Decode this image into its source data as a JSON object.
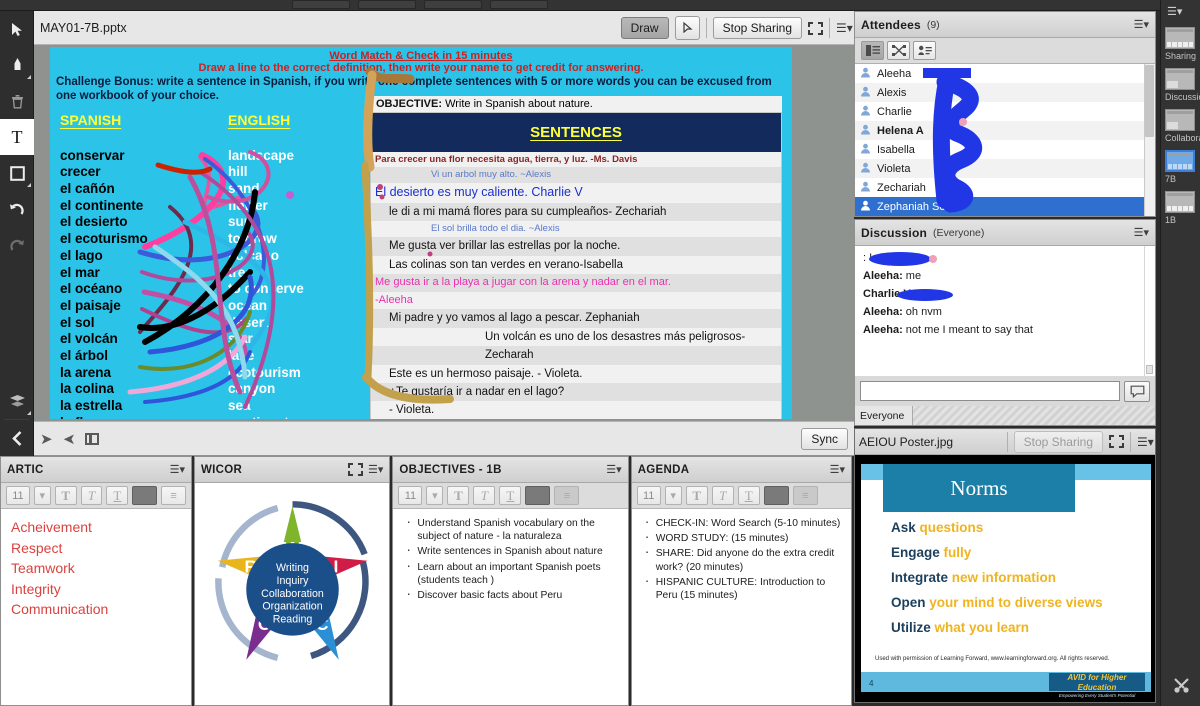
{
  "window": {
    "stage_title": "MAY01-7B.pptx",
    "draw_label": "Draw",
    "stop_sharing_label": "Stop Sharing",
    "sync_label": "Sync"
  },
  "tools": [
    {
      "name": "pointer-tool",
      "glyph": "➤"
    },
    {
      "name": "marker-tool",
      "glyph": "⮟"
    },
    {
      "name": "delete-tool",
      "glyph": "🗑"
    },
    {
      "name": "text-tool",
      "glyph": "T"
    },
    {
      "name": "shape-tool",
      "glyph": "□"
    },
    {
      "name": "undo-tool",
      "glyph": "↶"
    },
    {
      "name": "redo-tool",
      "glyph": "↷"
    },
    {
      "name": "layers-tool",
      "glyph": "≣"
    },
    {
      "name": "collapse-tool",
      "glyph": "‹"
    }
  ],
  "slide": {
    "heading_1": "Word Match & Check in 15 minutes",
    "heading_2": "Draw a line to the correct definition, then write your name to get credit for answering.",
    "challenge": "Challenge Bonus:  write a sentence in Spanish, if you write one complete sentences with 5 or more words you can be excused from one workbook of your choice.",
    "col_spanish": "SPANISH",
    "col_english": "ENGLISH",
    "spanish_words": [
      "conservar",
      "crecer",
      "el cañón",
      "el continente",
      "el desierto",
      "el ecoturismo",
      "el lago",
      "el mar",
      "el océano",
      "el paisaje",
      "el sol",
      "el volcán",
      "el árbol",
      "la arena",
      "la colina",
      "la estrella",
      "la flor"
    ],
    "english_words": [
      "landscape",
      "hill",
      "sand",
      "flower",
      "sun",
      "to grow",
      "volcano",
      "tree",
      "to conserve",
      "ocean",
      "desert",
      "star",
      "lake",
      "ecotourism",
      "canyon",
      "sea",
      "continent"
    ],
    "sentences_title": "SENTENCES",
    "sentences": [
      {
        "style": "maroon",
        "text": "Para crecer una flor necesita agua, tierra, y luz.   -Ms. Davis"
      },
      {
        "style": "blue-sm",
        "text": "Vi un arbol muy alto. ~Alexis"
      },
      {
        "style": "blue",
        "text": "El desierto es muy caliente. Charlie V"
      },
      {
        "style": "plain-ind",
        "text": "le di a mi mamá flores para su cumpleaños- Zechariah"
      },
      {
        "style": "blue-sm",
        "text": "El sol brilla todo el dia. ~Alexis"
      },
      {
        "style": "plain-ind",
        "text": "Me gusta ver brillar las estrellas por la noche."
      },
      {
        "style": "plain-ind",
        "text": "Las colinas son tan verdes en verano-Isabella"
      },
      {
        "style": "pink",
        "text": "Me gusta ir a la playa a jugar con la arena y nadar en el mar."
      },
      {
        "style": "pink",
        "text": "-Aleeha"
      },
      {
        "style": "plain-ind",
        "text": "Mi padre y yo vamos al lago a pescar. Zephaniah"
      },
      {
        "style": "plain-ind2",
        "text": "Un volcán es uno de los desastres más peligrosos-"
      },
      {
        "style": "plain-ind2",
        "text": "Zecharah"
      },
      {
        "style": "plain-ind",
        "text": "Este es un hermoso paisaje. - Violeta."
      },
      {
        "style": "plain-ind",
        "text": "¿Te gustaría ir a nadar en el lago?"
      },
      {
        "style": "plain-ind",
        "text": "- Violeta."
      }
    ],
    "objective_label": "OBJECTIVE:",
    "objective_text": " Write in Spanish about nature."
  },
  "attendees": {
    "title": "Attendees",
    "count": "(9)",
    "view_buttons": [
      "list-view",
      "breakout-view",
      "detail-view"
    ],
    "rows": [
      {
        "name": "Aleeha",
        "bold": false,
        "selected": false,
        "redacted": true
      },
      {
        "name": "Alexis",
        "bold": false,
        "selected": false,
        "redacted": false
      },
      {
        "name": "Charlie",
        "bold": false,
        "selected": false,
        "redacted": false
      },
      {
        "name": "Helena A",
        "bold": true,
        "selected": false,
        "redacted": false
      },
      {
        "name": "Isabella",
        "bold": false,
        "selected": false,
        "redacted": false
      },
      {
        "name": "Violeta",
        "bold": false,
        "selected": false,
        "redacted": false
      },
      {
        "name": "Zechariah",
        "bold": false,
        "selected": false,
        "redacted": false
      },
      {
        "name": "Zephaniah Senior",
        "bold": false,
        "selected": true,
        "redacted": false
      }
    ]
  },
  "discussion": {
    "title": "Discussion",
    "scope": "(Everyone)",
    "messages": [
      {
        "sender": "",
        "text": ": I said that"
      },
      {
        "sender": "Aleeha:",
        "text": " me"
      },
      {
        "sender": "Charlie V",
        "text": "not me"
      },
      {
        "sender": "Aleeha:",
        "text": " oh nvm"
      },
      {
        "sender": "Aleeha:",
        "text": " not me I meant to say that"
      }
    ],
    "input_placeholder": "",
    "send_icon": "chat-bubble-icon",
    "tab_label": "Everyone"
  },
  "poster": {
    "file_name": "AEIOU Poster.jpg",
    "stop_sharing_label": "Stop Sharing",
    "title": "Norms",
    "lines": [
      {
        "lead": "Ask",
        "rest": " questions"
      },
      {
        "lead": "Engage",
        "rest": " fully"
      },
      {
        "lead": "Integrate",
        "rest": " new information"
      },
      {
        "lead": "Open",
        "rest": " your mind to diverse views"
      },
      {
        "lead": "Utilize",
        "rest": " what you learn"
      }
    ],
    "credit": "Used with permission of Learning Forward, www.learningforward.org.  All rights reserved.",
    "page_number": "4",
    "brand": "AVID for Higher Education",
    "brand_sub": "Empowering Every Student's Potential",
    "lead_color": "#1c3f5c",
    "accent_color": "#efb41f"
  },
  "pods": {
    "artic": {
      "title": "ARTIC",
      "font_size": "11",
      "lines": [
        "Acheivement",
        "Respect",
        "Teamwork",
        "Integrity",
        "Communication"
      ],
      "text_color": "#d9433f"
    },
    "wicor": {
      "title": "WICOR",
      "points": [
        {
          "letter": "W",
          "color": "#7eb52c"
        },
        {
          "letter": "I",
          "color": "#cf1e45"
        },
        {
          "letter": "C",
          "color": "#2a8fd4"
        },
        {
          "letter": "O",
          "color": "#7a2c8f"
        },
        {
          "letter": "R",
          "color": "#e8b61c"
        }
      ],
      "center_words": [
        "Writing",
        "Inquiry",
        "Collaboration",
        "Organization",
        "Reading"
      ],
      "center_color": "#1b4f8a"
    },
    "objectives": {
      "title": "OBJECTIVES - 1B",
      "font_size": "11",
      "items": [
        "Understand Spanish vocabulary on the subject of nature - la naturaleza",
        "Write sentences in Spanish about nature",
        "Learn about an important Spanish poets (students teach )",
        "Discover basic facts about Peru"
      ]
    },
    "agenda": {
      "title": "AGENDA",
      "font_size": "11",
      "items": [
        "CHECK-IN: Word Search (5-10 minutes)",
        "WORD STUDY:  (15 minutes)",
        "SHARE: Did anyone do the extra credit work? (20 minutes)",
        "HISPANIC CULTURE: Introduction to Peru (15 minutes)"
      ]
    }
  },
  "layouts": [
    {
      "label": "Sharing",
      "selected": false
    },
    {
      "label": "Discussion",
      "selected": false
    },
    {
      "label": "Collaboration",
      "selected": false
    },
    {
      "label": "7B",
      "selected": true
    },
    {
      "label": "1B",
      "selected": false
    }
  ],
  "bottom_tool_icon": "tools-icon"
}
